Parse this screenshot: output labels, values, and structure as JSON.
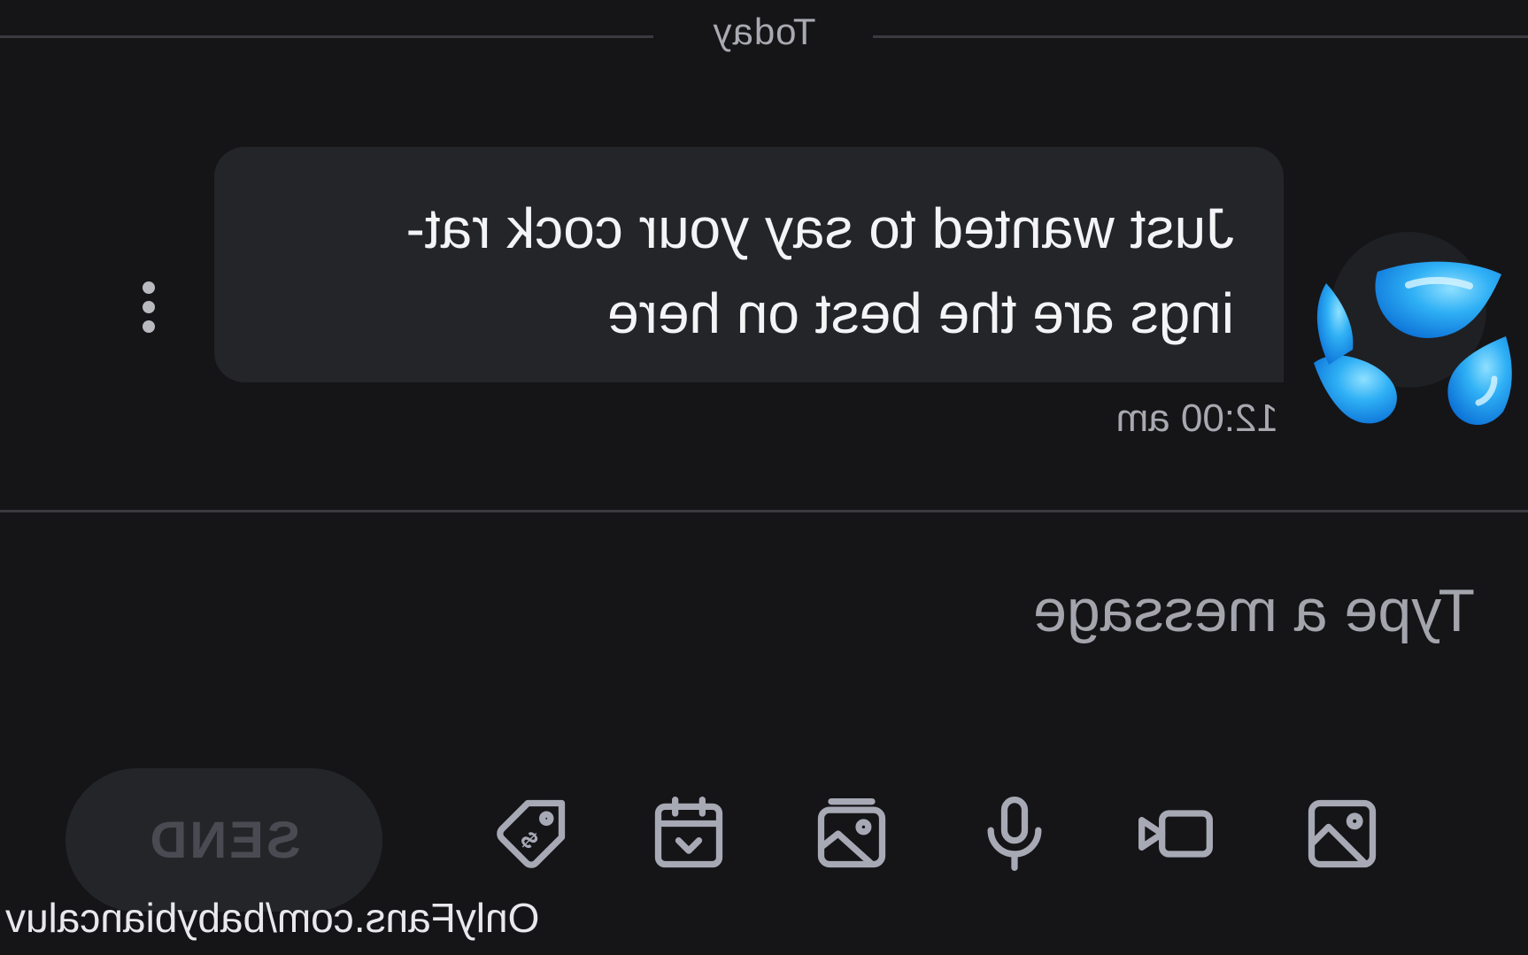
{
  "date_divider": "Today",
  "message": {
    "lines": [
      "Just wanted to say your cock rat-",
      "ings are the best on here"
    ],
    "timestamp": "12:00 am",
    "avatar_icon": "sweat-droplets-emoji"
  },
  "composer": {
    "placeholder": "Type a message",
    "send_label": "SEND",
    "tools": [
      "image-icon",
      "video-icon",
      "microphone-icon",
      "gallery-icon",
      "schedule-icon",
      "price-tag-icon"
    ]
  },
  "watermark": "OnlyFans.com/babybiancaluv",
  "colors": {
    "background": "#151518",
    "bubble": "#242529",
    "icon": "#a7a9b5",
    "droplet": "#1e9ef0"
  }
}
